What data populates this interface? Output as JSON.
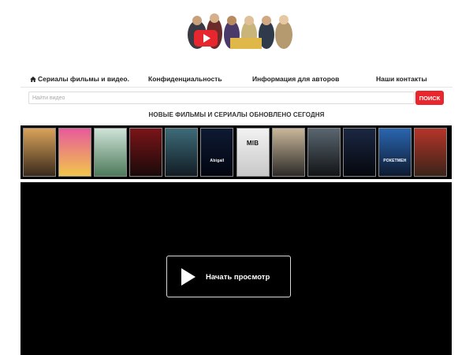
{
  "logo": {
    "badge_icon": "youtube-play-icon"
  },
  "nav": {
    "home_icon": "home-icon",
    "home": "Сериалы фильмы и видео.",
    "privacy": "Конфиденциальность",
    "authors": "Информация для авторов",
    "contacts": "Наши контакты"
  },
  "search": {
    "placeholder": "Найти видео",
    "button": "ПОИСК"
  },
  "headline": "НОВЫЕ ФИЛЬМЫ И СЕРИАЛЫ ОБНОВЛЕНО СЕГОДНЯ",
  "posters": [
    {
      "title": "",
      "colors": [
        "#d9a35a",
        "#3a2a1c"
      ]
    },
    {
      "title": "",
      "colors": [
        "#e85a9c",
        "#f0c64a"
      ]
    },
    {
      "title": "",
      "colors": [
        "#cfe3d7",
        "#4c7a5a"
      ]
    },
    {
      "title": "",
      "colors": [
        "#7a1418",
        "#1a0a0a"
      ]
    },
    {
      "title": "",
      "colors": [
        "#3d6b78",
        "#121c24"
      ]
    },
    {
      "title": "Abigail",
      "colors": [
        "#0e1a33",
        "#020510"
      ]
    },
    {
      "title": "MIB",
      "colors": [
        "#f2f2f2",
        "#c8c8c8"
      ]
    },
    {
      "title": "",
      "colors": [
        "#c9b79a",
        "#2c2a28"
      ]
    },
    {
      "title": "",
      "colors": [
        "#5a6670",
        "#121416"
      ]
    },
    {
      "title": "",
      "colors": [
        "#1b2742",
        "#05070d"
      ]
    },
    {
      "title": "РОКЕТМЕН",
      "colors": [
        "#2a66b0",
        "#0d1a30"
      ]
    },
    {
      "title": "",
      "colors": [
        "#b5342a",
        "#3a2418"
      ]
    }
  ],
  "player": {
    "play_icon": "play-icon",
    "label": "Начать просмотр"
  },
  "colors": {
    "accent": "#e8262d",
    "player_bg": "#000000"
  }
}
